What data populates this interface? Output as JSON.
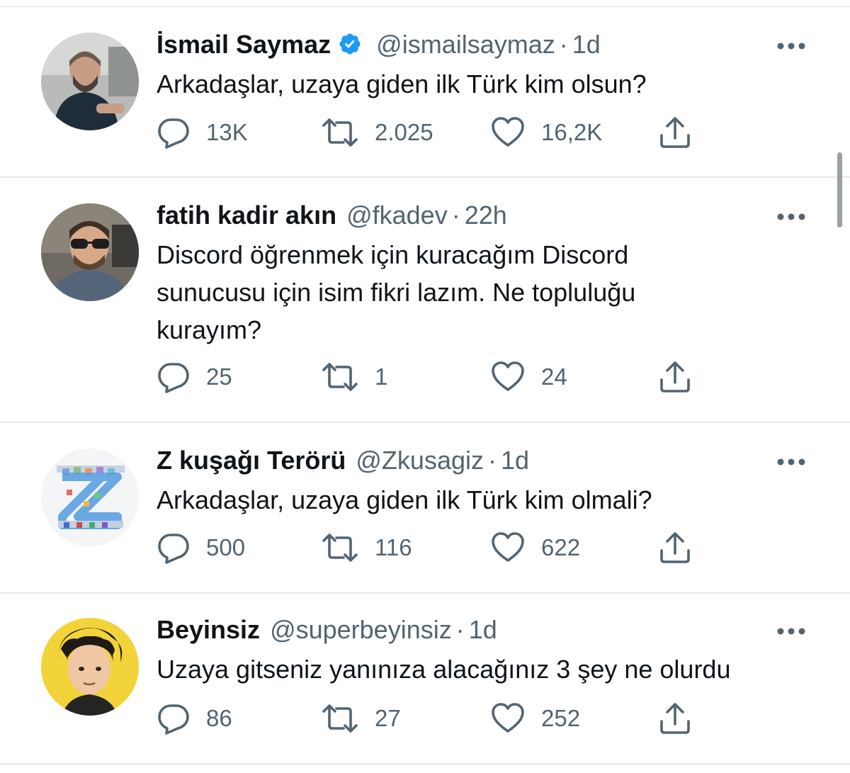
{
  "tweets": [
    {
      "name": "İsmail Saymaz",
      "verified": true,
      "handle": "@ismailsaymaz",
      "separator": "·",
      "time": "1d",
      "text_lines": [
        "Arkadaşlar, uzaya giden ilk Türk kim olsun?"
      ],
      "replies": "13K",
      "retweets": "2.025",
      "likes": "16,2K"
    },
    {
      "name": "fatih kadir akın",
      "verified": false,
      "handle": "@fkadev",
      "separator": "·",
      "time": "22h",
      "text_lines": [
        "Discord öğrenmek için kuracağım Discord",
        "sunucusu için isim fikri lazım. Ne topluluğu",
        "kurayım?"
      ],
      "replies": "25",
      "retweets": "1",
      "likes": "24"
    },
    {
      "name": "Z kuşağı Terörü",
      "verified": false,
      "handle": "@Zkusagiz",
      "separator": "·",
      "time": "1d",
      "text_lines": [
        "Arkadaşlar, uzaya giden ilk Türk kim olmali?"
      ],
      "replies": "500",
      "retweets": "116",
      "likes": "622"
    },
    {
      "name": "Beyinsiz",
      "verified": false,
      "handle": "@superbeyinsiz",
      "separator": "·",
      "time": "1d",
      "text_lines": [
        "Uzaya gitseniz yanınıza alacağınız 3 şey ne olurdu"
      ],
      "replies": "86",
      "retweets": "27",
      "likes": "252"
    }
  ],
  "icons": {
    "reply": "reply-icon",
    "retweet": "retweet-icon",
    "like": "like-icon",
    "share": "share-icon",
    "more": "more-icon",
    "verified": "verified-badge-icon"
  },
  "colors": {
    "verified": "#1d9bf0",
    "text": "#0f1419",
    "secondary": "#536471",
    "divider": "#e5e8ea"
  }
}
